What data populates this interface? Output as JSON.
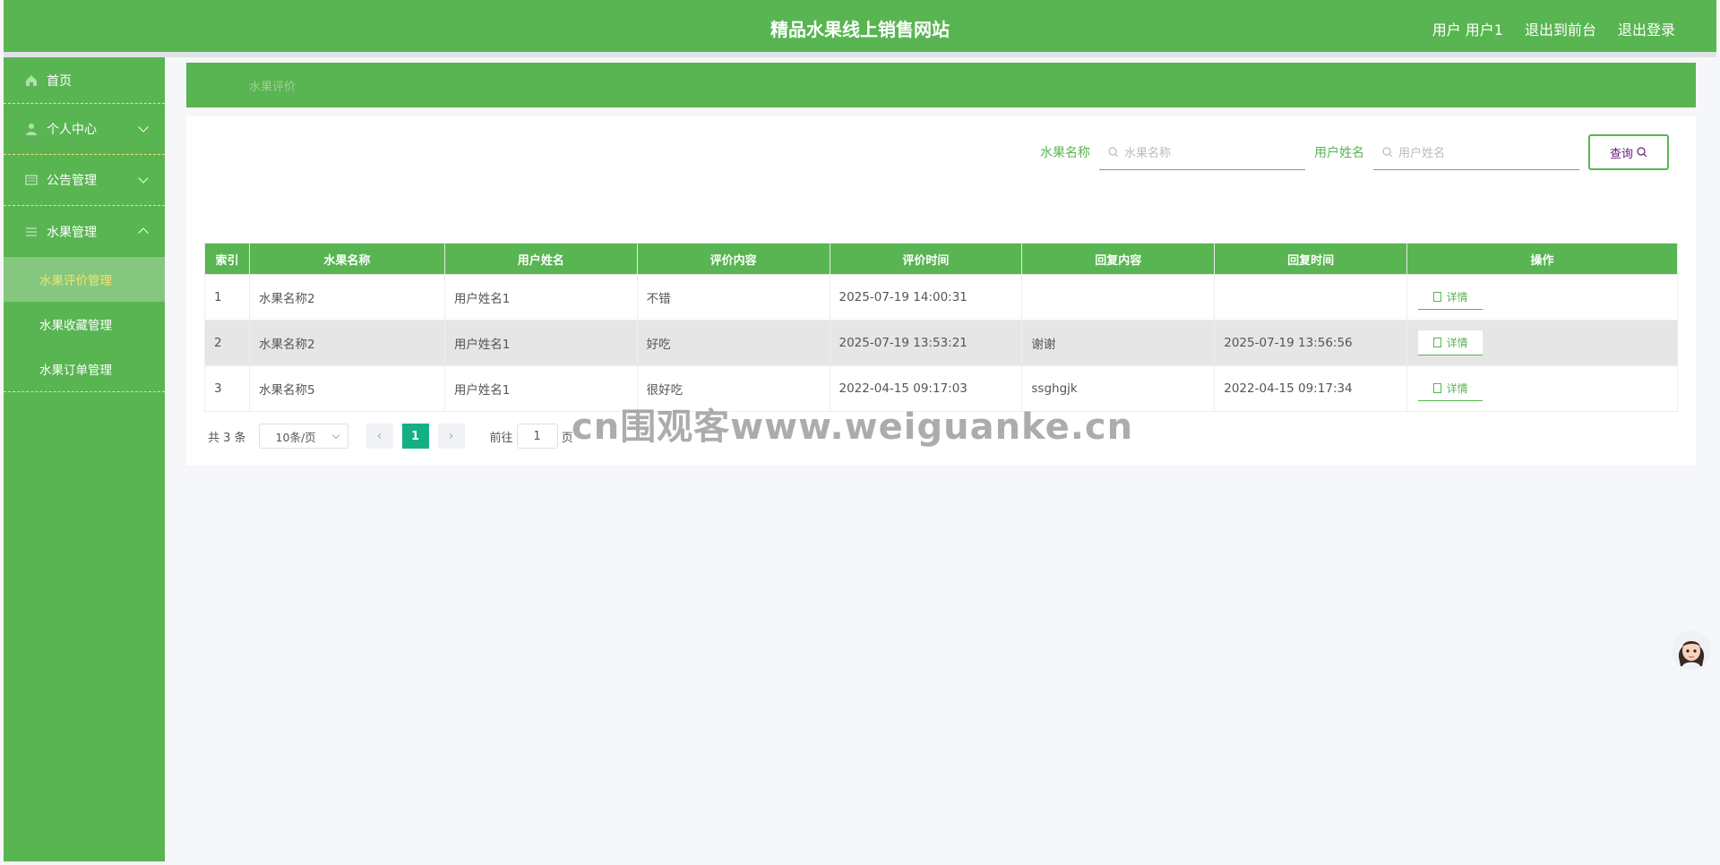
{
  "header": {
    "title": "精品水果线上销售网站",
    "user_label": "用户 用户1",
    "back_front": "退出到前台",
    "logout": "退出登录"
  },
  "sidebar": {
    "home": "首页",
    "personal": "个人中心",
    "notice": "公告管理",
    "fruit": "水果管理",
    "sub": [
      "水果评价管理",
      "水果收藏管理",
      "水果订单管理"
    ]
  },
  "breadcrumb": "水果评价",
  "search": {
    "fruit_label": "水果名称",
    "fruit_placeholder": "水果名称",
    "user_label": "用户姓名",
    "user_placeholder": "用户姓名",
    "button": "查询"
  },
  "table": {
    "headers": [
      "索引",
      "水果名称",
      "用户姓名",
      "评价内容",
      "评价时间",
      "回复内容",
      "回复时间",
      "操作"
    ],
    "detail_label": "详情",
    "rows": [
      [
        "1",
        "水果名称2",
        "用户姓名1",
        "不错",
        "2025-07-19 14:00:31",
        "",
        ""
      ],
      [
        "2",
        "水果名称2",
        "用户姓名1",
        "好吃",
        "2025-07-19 13:53:21",
        "谢谢",
        "2025-07-19 13:56:56"
      ],
      [
        "3",
        "水果名称5",
        "用户姓名1",
        "很好吃",
        "2022-04-15 09:17:03",
        "ssghgjk",
        "2022-04-15 09:17:34"
      ]
    ]
  },
  "pager": {
    "total": "共 3 条",
    "page_size": "10条/页",
    "current": "1",
    "goto_prefix": "前往",
    "goto_value": "1",
    "goto_suffix": "页"
  },
  "watermark": "cn围观客www.weiguanke.cn",
  "colors": {
    "primary": "#58b551",
    "active_text": "#f5e46a",
    "page_active": "#13b087"
  }
}
